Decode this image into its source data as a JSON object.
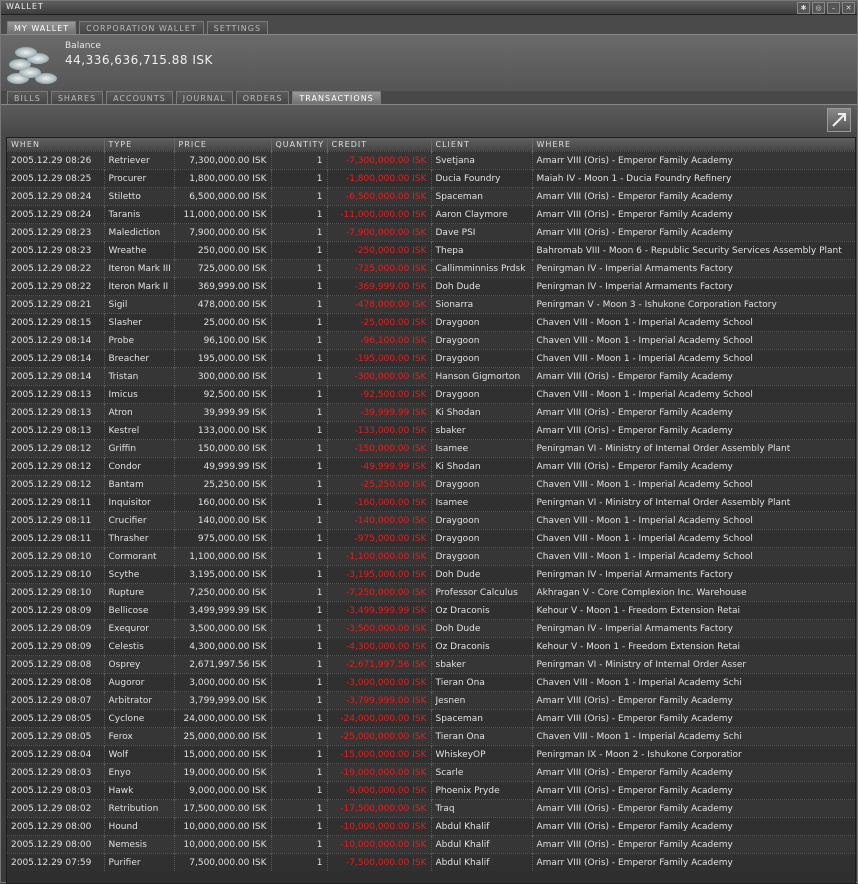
{
  "window": {
    "title": "WALLET"
  },
  "top_tabs": [
    "MY WALLET",
    "CORPORATION WALLET",
    "SETTINGS"
  ],
  "balance": {
    "label": "Balance",
    "value": "44,336,636,715.88 ISK"
  },
  "sub_tabs": [
    "BILLS",
    "SHARES",
    "ACCOUNTS",
    "JOURNAL",
    "ORDERS",
    "TRANSACTIONS"
  ],
  "table": {
    "columns": [
      "WHEN",
      "TYPE",
      "PRICE",
      "QUANTITY",
      "CREDIT",
      "CLIENT",
      "WHERE"
    ],
    "rows": [
      [
        "2005.12.29 08:26",
        "Retriever",
        "7,300,000.00 ISK",
        "1",
        "-7,300,000.00 ISK",
        "Svetjana",
        "Amarr VIII (Oris) - Emperor Family Academy"
      ],
      [
        "2005.12.29 08:25",
        "Procurer",
        "1,800,000.00 ISK",
        "1",
        "-1,800,000.00 ISK",
        "Ducia Foundry",
        "Maiah IV - Moon 1 - Ducia Foundry Refinery"
      ],
      [
        "2005.12.29 08:24",
        "Stiletto",
        "6,500,000.00 ISK",
        "1",
        "-6,500,000.00 ISK",
        "Spaceman",
        "Amarr VIII (Oris) - Emperor Family Academy"
      ],
      [
        "2005.12.29 08:24",
        "Taranis",
        "11,000,000.00 ISK",
        "1",
        "-11,000,000.00 ISK",
        "Aaron Claymore",
        "Amarr VIII (Oris) - Emperor Family Academy"
      ],
      [
        "2005.12.29 08:23",
        "Malediction",
        "7,900,000.00 ISK",
        "1",
        "-7,900,000.00 ISK",
        "Dave PSI",
        "Amarr VIII (Oris) - Emperor Family Academy"
      ],
      [
        "2005.12.29 08:23",
        "Wreathe",
        "250,000.00 ISK",
        "1",
        "-250,000.00 ISK",
        "Thepa",
        "Bahromab VIII - Moon 6 - Republic Security Services Assembly Plant"
      ],
      [
        "2005.12.29 08:22",
        "Iteron Mark III",
        "725,000.00 ISK",
        "1",
        "-725,000.00 ISK",
        "Callimminniss Prdsk",
        "Penirgman IV - Imperial Armaments Factory"
      ],
      [
        "2005.12.29 08:22",
        "Iteron Mark II",
        "369,999.00 ISK",
        "1",
        "-369,999.00 ISK",
        "Doh Dude",
        "Penirgman IV - Imperial Armaments Factory"
      ],
      [
        "2005.12.29 08:21",
        "Sigil",
        "478,000.00 ISK",
        "1",
        "-478,000.00 ISK",
        "Sionarra",
        "Penirgman V - Moon 3 - Ishukone Corporation Factory"
      ],
      [
        "2005.12.29 08:15",
        "Slasher",
        "25,000.00 ISK",
        "1",
        "-25,000.00 ISK",
        "Draygoon",
        "Chaven VIII - Moon 1 - Imperial Academy School"
      ],
      [
        "2005.12.29 08:14",
        "Probe",
        "96,100.00 ISK",
        "1",
        "-96,100.00 ISK",
        "Draygoon",
        "Chaven VIII - Moon 1 - Imperial Academy School"
      ],
      [
        "2005.12.29 08:14",
        "Breacher",
        "195,000.00 ISK",
        "1",
        "-195,000.00 ISK",
        "Draygoon",
        "Chaven VIII - Moon 1 - Imperial Academy School"
      ],
      [
        "2005.12.29 08:14",
        "Tristan",
        "300,000.00 ISK",
        "1",
        "-300,000.00 ISK",
        "Hanson Gigmorton",
        "Amarr VIII (Oris) - Emperor Family Academy"
      ],
      [
        "2005.12.29 08:13",
        "Imicus",
        "92,500.00 ISK",
        "1",
        "-92,500.00 ISK",
        "Draygoon",
        "Chaven VIII - Moon 1 - Imperial Academy School"
      ],
      [
        "2005.12.29 08:13",
        "Atron",
        "39,999.99 ISK",
        "1",
        "-39,999.99 ISK",
        "Ki Shodan",
        "Amarr VIII (Oris) - Emperor Family Academy"
      ],
      [
        "2005.12.29 08:13",
        "Kestrel",
        "133,000.00 ISK",
        "1",
        "-133,000.00 ISK",
        "sbaker",
        "Amarr VIII (Oris) - Emperor Family Academy"
      ],
      [
        "2005.12.29 08:12",
        "Griffin",
        "150,000.00 ISK",
        "1",
        "-150,000.00 ISK",
        "Isamee",
        "Penirgman VI - Ministry of Internal Order Assembly Plant"
      ],
      [
        "2005.12.29 08:12",
        "Condor",
        "49,999.99 ISK",
        "1",
        "-49,999.99 ISK",
        "Ki Shodan",
        "Amarr VIII (Oris) - Emperor Family Academy"
      ],
      [
        "2005.12.29 08:12",
        "Bantam",
        "25,250.00 ISK",
        "1",
        "-25,250.00 ISK",
        "Draygoon",
        "Chaven VIII - Moon 1 - Imperial Academy School"
      ],
      [
        "2005.12.29 08:11",
        "Inquisitor",
        "160,000.00 ISK",
        "1",
        "-160,000.00 ISK",
        "Isamee",
        "Penirgman VI - Ministry of Internal Order Assembly Plant"
      ],
      [
        "2005.12.29 08:11",
        "Crucifier",
        "140,000.00 ISK",
        "1",
        "-140,000.00 ISK",
        "Draygoon",
        "Chaven VIII - Moon 1 - Imperial Academy School"
      ],
      [
        "2005.12.29 08:11",
        "Thrasher",
        "975,000.00 ISK",
        "1",
        "-975,000.00 ISK",
        "Draygoon",
        "Chaven VIII - Moon 1 - Imperial Academy School"
      ],
      [
        "2005.12.29 08:10",
        "Cormorant",
        "1,100,000.00 ISK",
        "1",
        "-1,100,000.00 ISK",
        "Draygoon",
        "Chaven VIII - Moon 1 - Imperial Academy School"
      ],
      [
        "2005.12.29 08:10",
        "Scythe",
        "3,195,000.00 ISK",
        "1",
        "-3,195,000.00 ISK",
        "Doh Dude",
        "Penirgman IV - Imperial Armaments Factory"
      ],
      [
        "2005.12.29 08:10",
        "Rupture",
        "7,250,000.00 ISK",
        "1",
        "-7,250,000.00 ISK",
        "Professor Calculus",
        "Akhragan V - Core Complexion Inc. Warehouse"
      ],
      [
        "2005.12.29 08:09",
        "Bellicose",
        "3,499,999.99 ISK",
        "1",
        "-3,499,999.99 ISK",
        "Oz Draconis",
        "Kehour V - Moon 1 - Freedom Extension Retai"
      ],
      [
        "2005.12.29 08:09",
        "Exequror",
        "3,500,000.00 ISK",
        "1",
        "-3,500,000.00 ISK",
        "Doh Dude",
        "Penirgman IV - Imperial Armaments Factory"
      ],
      [
        "2005.12.29 08:09",
        "Celestis",
        "4,300,000.00 ISK",
        "1",
        "-4,300,000.00 ISK",
        "Oz Draconis",
        "Kehour V - Moon 1 - Freedom Extension Retai"
      ],
      [
        "2005.12.29 08:08",
        "Osprey",
        "2,671,997.56 ISK",
        "1",
        "-2,671,997.56 ISK",
        "sbaker",
        "Penirgman VI - Ministry of Internal Order Asser"
      ],
      [
        "2005.12.29 08:08",
        "Augoror",
        "3,000,000.00 ISK",
        "1",
        "-3,000,000.00 ISK",
        "Tieran Ona",
        "Chaven VIII - Moon 1 - Imperial Academy Schi"
      ],
      [
        "2005.12.29 08:07",
        "Arbitrator",
        "3,799,999.00 ISK",
        "1",
        "-3,799,999.00 ISK",
        "Jesnen",
        "Amarr VIII (Oris) - Emperor Family Academy"
      ],
      [
        "2005.12.29 08:05",
        "Cyclone",
        "24,000,000.00 ISK",
        "1",
        "-24,000,000.00 ISK",
        "Spaceman",
        "Amarr VIII (Oris) - Emperor Family Academy"
      ],
      [
        "2005.12.29 08:05",
        "Ferox",
        "25,000,000.00 ISK",
        "1",
        "-25,000,000.00 ISK",
        "Tieran Ona",
        "Chaven VIII - Moon 1 - Imperial Academy Schi"
      ],
      [
        "2005.12.29 08:04",
        "Wolf",
        "15,000,000.00 ISK",
        "1",
        "-15,000,000.00 ISK",
        "WhiskeyOP",
        "Penirgman IX - Moon 2 - Ishukone Corporatior"
      ],
      [
        "2005.12.29 08:03",
        "Enyo",
        "19,000,000.00 ISK",
        "1",
        "-19,000,000.00 ISK",
        "Scarle",
        "Amarr VIII (Oris) - Emperor Family Academy"
      ],
      [
        "2005.12.29 08:03",
        "Hawk",
        "9,000,000.00 ISK",
        "1",
        "-9,000,000.00 ISK",
        "Phoenix Pryde",
        "Amarr VIII (Oris) - Emperor Family Academy"
      ],
      [
        "2005.12.29 08:02",
        "Retribution",
        "17,500,000.00 ISK",
        "1",
        "-17,500,000.00 ISK",
        "Traq",
        "Amarr VIII (Oris) - Emperor Family Academy"
      ],
      [
        "2005.12.29 08:00",
        "Hound",
        "10,000,000.00 ISK",
        "1",
        "-10,000,000.00 ISK",
        "Abdul Khalif",
        "Amarr VIII (Oris) - Emperor Family Academy"
      ],
      [
        "2005.12.29 08:00",
        "Nemesis",
        "10,000,000.00 ISK",
        "1",
        "-10,000,000.00 ISK",
        "Abdul Khalif",
        "Amarr VIII (Oris) - Emperor Family Academy"
      ],
      [
        "2005.12.29 07:59",
        "Purifier",
        "7,500,000.00 ISK",
        "1",
        "-7,500,000.00 ISK",
        "Abdul Khalif",
        "Amarr VIII (Oris) - Emperor Family Academy"
      ]
    ]
  }
}
